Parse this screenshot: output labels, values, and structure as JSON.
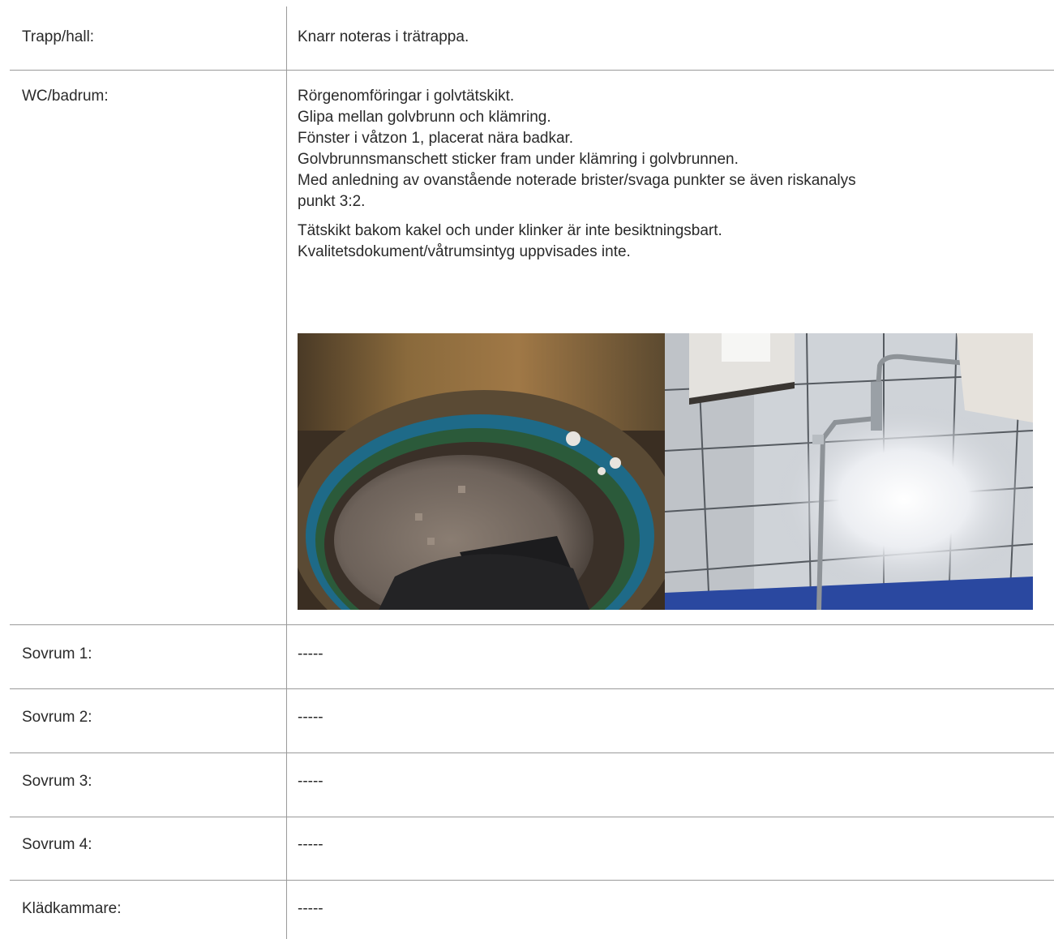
{
  "rows": [
    {
      "label": "Trapp/hall:",
      "lines": [
        "Knarr noteras i trätrappa."
      ]
    },
    {
      "label": "WC/badrum:",
      "paragraphs": [
        [
          "Rörgenomföringar i golvtätskikt.",
          "Glipa mellan golvbrunn och klämring.",
          "Fönster i våtzon 1, placerat nära badkar.",
          "Golvbrunnsmanschett sticker fram under klämring i golvbrunnen.",
          "Med anledning av ovanstående noterade brister/svaga punkter se även riskanalys",
          "punkt 3:2."
        ],
        [
          "Tätskikt bakom kakel och under klinker är inte besiktningsbart.",
          "Kvalitetsdokument/våtrumsintyg uppvisades inte."
        ]
      ]
    },
    {
      "label": "Sovrum 1:",
      "lines": [
        "-----"
      ]
    },
    {
      "label": "Sovrum 2:",
      "lines": [
        "-----"
      ]
    },
    {
      "label": "Sovrum 3:",
      "lines": [
        "-----"
      ]
    },
    {
      "label": "Sovrum 4:",
      "lines": [
        "-----"
      ]
    },
    {
      "label": "Klädkammare:",
      "lines": [
        "-----"
      ]
    }
  ]
}
